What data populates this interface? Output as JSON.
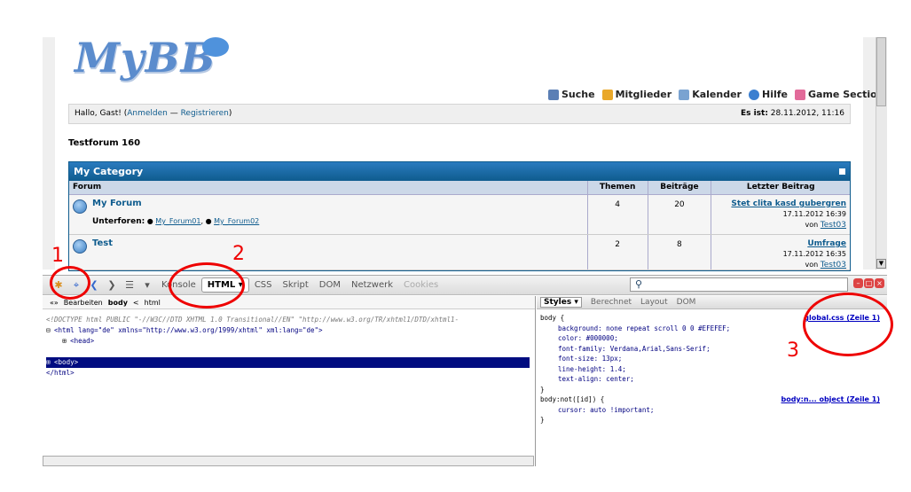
{
  "mybb": {
    "logo": "MyBB",
    "toplinks": [
      {
        "label": "Suche",
        "icon": "search-icon",
        "color": "#5b7fb5"
      },
      {
        "label": "Mitglieder",
        "icon": "members-icon",
        "color": "#e9a82a"
      },
      {
        "label": "Kalender",
        "icon": "calendar-icon",
        "color": "#7aa3d1"
      },
      {
        "label": "Hilfe",
        "icon": "help-icon",
        "color": "#3b7fd0"
      },
      {
        "label": "Game Section",
        "icon": "game-icon",
        "color": "#e26b9a"
      }
    ],
    "welcome_prefix": "Hallo, Gast! (",
    "login": "Anmelden",
    "dash": " — ",
    "register": "Registrieren",
    "welcome_suffix": ")",
    "date_label": "Es ist:",
    "date_value": "28.11.2012, 11:16",
    "board_title": "Testforum 160",
    "category": "My Category",
    "columns": [
      "Forum",
      "Themen",
      "Beiträge",
      "Letzter Beitrag"
    ],
    "forums": [
      {
        "name": "My Forum",
        "sub_label": "Unterforen:",
        "subforums": [
          "My_Forum01",
          "My_Forum02"
        ],
        "threads": "4",
        "posts": "20",
        "last_title": "Stet clita kasd gubergren",
        "last_date": "17.11.2012 16:39",
        "last_by": "von",
        "last_user": "Test03"
      },
      {
        "name": "Test",
        "threads": "2",
        "posts": "8",
        "last_title": "Umfrage",
        "last_date": "17.11.2012 16:35",
        "last_by": "von",
        "last_user": "Test03"
      }
    ]
  },
  "firebug": {
    "tabs": [
      "Konsole",
      "HTML",
      "CSS",
      "Skript",
      "DOM",
      "Netzwerk",
      "Cookies"
    ],
    "active_tab": "HTML",
    "breadcrumb": {
      "edit": "Bearbeiten",
      "body": "body",
      "sep": "<",
      "html": "html"
    },
    "code": {
      "doctype": "<!DOCTYPE html PUBLIC \"-//W3C//DTD XHTML 1.0 Transitional//EN\" \"http://www.w3.org/TR/xhtml1/DTD/xhtml1-",
      "html_open": "<html lang=\"de\" xmlns=\"http://www.w3.org/1999/xhtml\" xml:lang=\"de\">",
      "head": "<head>",
      "body": "<body>",
      "html_close": "</html>"
    },
    "side_tabs": [
      "Styles",
      "Berechnet",
      "Layout",
      "DOM"
    ],
    "styles": {
      "rule1_selector": "body {",
      "rule1_source": "global.css (Zeile 1)",
      "rule1_props": [
        "background: none repeat scroll 0 0 #EFEFEF;",
        "color: #000000;",
        "font-family: Verdana,Arial,Sans-Serif;",
        "font-size: 13px;",
        "line-height: 1.4;",
        "text-align: center;"
      ],
      "close": "}",
      "rule2_selector": "body:not([id]) {",
      "rule2_source": "body:n... object (Zeile 1)",
      "rule2_props": [
        "cursor: auto !important;"
      ]
    }
  },
  "annotations": [
    "1",
    "2",
    "3"
  ]
}
